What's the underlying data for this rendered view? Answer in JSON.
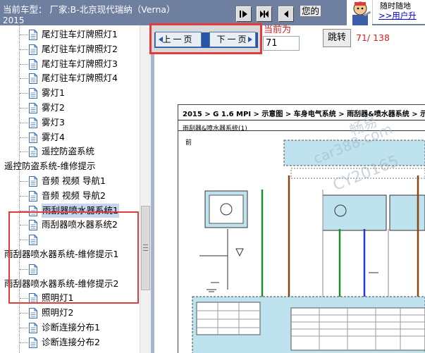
{
  "header": {
    "title": "当前车型： 厂家:B-北京现代瑞纳（Verna）",
    "title_line2": "2015",
    "welcome": "您的",
    "ad_line1": "随时随地",
    "ad_link": ">>用户升"
  },
  "tree": {
    "items": [
      {
        "label": "尾灯驻车灯牌照灯1",
        "level": 2
      },
      {
        "label": "尾灯驻车灯牌照灯2",
        "level": 2
      },
      {
        "label": "尾灯驻车灯牌照灯3",
        "level": 2
      },
      {
        "label": "尾灯驻车灯牌照灯4",
        "level": 2
      },
      {
        "label": "雾灯1",
        "level": 2
      },
      {
        "label": "雾灯2",
        "level": 2
      },
      {
        "label": "雾灯3",
        "level": 2
      },
      {
        "label": "雾灯4",
        "level": 2
      },
      {
        "label": "遥控防盗系统",
        "level": 2
      },
      {
        "label": "遥控防盗系统-维修提示",
        "level": 0
      },
      {
        "label": "音频 视频 导航1",
        "level": 2
      },
      {
        "label": "音频 视频 导航2",
        "level": 2
      },
      {
        "label": "雨刮器喷水器系统1",
        "level": 2,
        "selected": true
      },
      {
        "label": "雨刮器喷水器系统2",
        "level": 2
      },
      {
        "label": "",
        "level": 2
      },
      {
        "label": "雨刮器喷水器系统-维修提示1",
        "level": 0
      },
      {
        "label": "",
        "level": 2
      },
      {
        "label": "雨刮器喷水器系统-维修提示2",
        "level": 0
      },
      {
        "label": "照明灯1",
        "level": 2
      },
      {
        "label": "照明灯2",
        "level": 2
      },
      {
        "label": "诊断连接分布1",
        "level": 2
      },
      {
        "label": "诊断连接分布2",
        "level": 2
      }
    ]
  },
  "nav": {
    "prev_label": "上一页",
    "next_label": "下一页",
    "current_label": "当前为",
    "page_value": "71",
    "jump_label": "跳转",
    "page_count": "71/ 138"
  },
  "diagram": {
    "breadcrumb": "2015 > G 1.6 MPI > 示意图 > 车身电气系统 > 雨刮器&喷水器系统 > 示意图",
    "system_title": "雨刮器&喷水器系统(1)",
    "front_label": "前",
    "watermark_1": "畅易",
    "watermark_2": "car388.com",
    "watermark_3": "CY20165"
  },
  "colors": {
    "header_bg": "#6f7fa0",
    "highlight": "#e23b3b",
    "selection": "#c7d5ee",
    "divider": "#a6b6cf",
    "page_count_text": "#d42020"
  },
  "icons": [
    "document-icon",
    "first-page-icon",
    "fit-icon",
    "prev-icon",
    "mascot-icon",
    "prev-arrow-icon",
    "next-arrow-icon"
  ]
}
